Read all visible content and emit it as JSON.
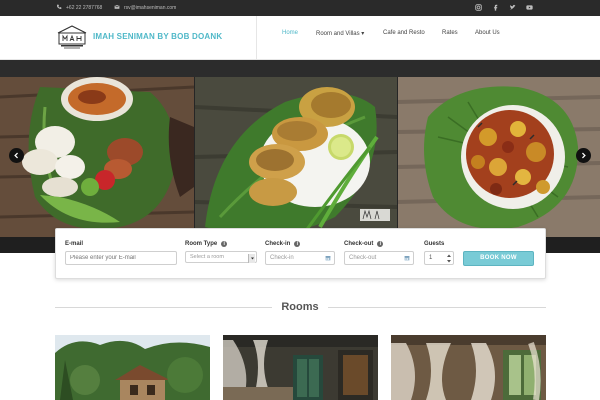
{
  "topbar": {
    "phone": "+62 22 2787768",
    "email": "rsv@imahseniman.com",
    "social_icons": [
      "instagram-icon",
      "facebook-icon",
      "twitter-icon",
      "youtube-icon"
    ]
  },
  "header": {
    "brand": "IMAH SENIMAN BY BOB DOANK",
    "nav": [
      {
        "label": "Home",
        "active": true
      },
      {
        "label": "Room and Villas ▾",
        "active": false
      },
      {
        "label": "Cafe and Resto",
        "active": false
      },
      {
        "label": "Rates",
        "active": false
      },
      {
        "label": "About Us",
        "active": false
      }
    ]
  },
  "slider": {
    "slides": [
      "fried-crackers-and-sambal-platter",
      "fried-fish-on-banana-leaf",
      "sweet-sour-dish-on-banana-leaf"
    ]
  },
  "booking": {
    "email": {
      "label": "E-mail",
      "placeholder": "Please enter your E-mail"
    },
    "room_type": {
      "label": "Room Type",
      "selected": "Select a room"
    },
    "checkin": {
      "label": "Check-in",
      "placeholder": "Check-in"
    },
    "checkout": {
      "label": "Check-out",
      "placeholder": "Check-out"
    },
    "guests": {
      "label": "Guests",
      "value": "1"
    },
    "button": "BOOK NOW"
  },
  "rooms": {
    "title": "Rooms",
    "cards": [
      "garden-villa",
      "canopy-bedroom",
      "curtained-suite"
    ]
  },
  "colors": {
    "accent": "#4fb8c8",
    "button": "#79cbd6",
    "topbar": "#2a2a2a"
  }
}
